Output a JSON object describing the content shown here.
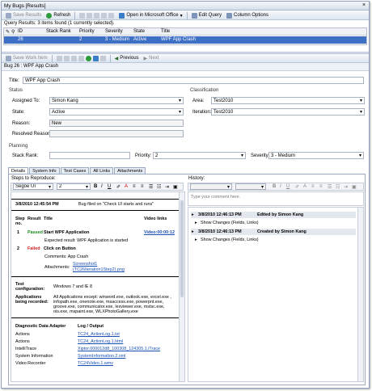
{
  "window": {
    "title": "My Bugs [Results]"
  },
  "toolbar1": {
    "save_results": "Save Results",
    "refresh": "Refresh",
    "open_office": "Open in Microsoft Office",
    "edit_query": "Edit Query",
    "column_options": "Column Options"
  },
  "query": {
    "summary": "Query Results: 3 items found (1 currently selected).",
    "columns": [
      "ID",
      "Stack Rank",
      "Priority",
      "Severity",
      "State",
      "Title"
    ],
    "rows": [
      [
        "26",
        "",
        "2",
        "3 - Medium",
        "Active",
        "WPF App Crash"
      ]
    ]
  },
  "toolbar2": {
    "save_item": "Save Work Item",
    "previous": "Previous",
    "next": "Next"
  },
  "item": {
    "header": "Bug 26 : WPF App Crash",
    "title_label": "Title:",
    "title_value": "WPF App Crash"
  },
  "status": {
    "heading": "Status",
    "assigned_label": "Assigned To:",
    "assigned_value": "Simon Kang",
    "state_label": "State:",
    "state_value": "Active",
    "reason_label": "Reason:",
    "reason_value": "New",
    "resolved_label": "Resolved Reason:"
  },
  "classification": {
    "heading": "Classification",
    "area_label": "Area:",
    "area_value": "Test2010",
    "iteration_label": "Iteration:",
    "iteration_value": "Test2010"
  },
  "planning": {
    "heading": "Planning",
    "stack_label": "Stack Rank:",
    "priority_label": "Priority:",
    "priority_value": "2",
    "severity_label": "Severity:",
    "severity_value": "3 - Medium"
  },
  "tabs": [
    "Details",
    "System Info",
    "Test Cases",
    "All Links",
    "Attachments"
  ],
  "repro": {
    "label": "Steps to Reproduce:",
    "font": "Segoe UI",
    "size": "2",
    "timestamp": "3/8/2010 12:45:54 PM",
    "filed": "Bug filed on \"Check UI starts and runs\"",
    "col_step": "Step",
    "col_no": "no.",
    "col_result": "Result",
    "col_title": "Title",
    "col_video": "Video links",
    "s1_no": "1",
    "s1_result": "Passed",
    "s1_title": "Start WPF Application",
    "s1_video": "Video:00:00:12",
    "s1_expected": "Expected result: WPF Application is started",
    "s2_no": "2",
    "s2_result": "Failed",
    "s2_title": "Click on Button",
    "s2_comments": "Comments: App Crash",
    "s2_attach_label": "Attachments:",
    "s2_attach1": "Screenshot1",
    "s2_attach2": "(TC26Iteration1Step2).png",
    "tc_label1": "Test",
    "tc_label2": "configuration:",
    "tc_value": "Windows 7 and IE 8",
    "apps_label1": "Applications",
    "apps_label2": "being recorded:",
    "apps_value1": "All Applications except: winword.exe, outlook.exe, excel.exe ,",
    "apps_value2": "infopath.exe, onenote.exe, msaccess.exe, powerpnt.exe,",
    "apps_value3": "groove.exe, communicator.exe, lexviewer.exe, mstsc.exe,",
    "apps_value4": "ois.exe, mspaint.exe, WLXPhotoGallery.exe",
    "dda_heading": "Diagnostic Data Adapter",
    "log_heading": "Log / Output",
    "adapters": [
      {
        "name": "Actions",
        "log": "TC24_ActionLog.1.txt"
      },
      {
        "name": "Actions",
        "log": "TC24_ActionLog.1.html"
      },
      {
        "name": "IntelliTrace",
        "log": "Xiptor.000012d8_100308_124305.1.iTrace"
      },
      {
        "name": "System Information",
        "log": "SystemInformation.2.xml"
      },
      {
        "name": "Video Recorder",
        "log": "TC24Video.1.wmv"
      }
    ]
  },
  "history": {
    "label": "History:",
    "placeholder": "Type your comment here.",
    "e1_time": "3/8/2010 12:46:13 PM",
    "e1_by": "Edited by Simon Kang",
    "e1_show": "Show Changes (Fields, Links)",
    "e2_time": "3/8/2010 12:46:13 PM",
    "e2_by": "Created by Simon Kang",
    "e2_show": "Show Changes (Fields, Links)"
  },
  "colors": {
    "passed": "#1a8a1a",
    "failed": "#d02020",
    "link": "#1a4fb4",
    "header_bg": "#dde5f0"
  }
}
